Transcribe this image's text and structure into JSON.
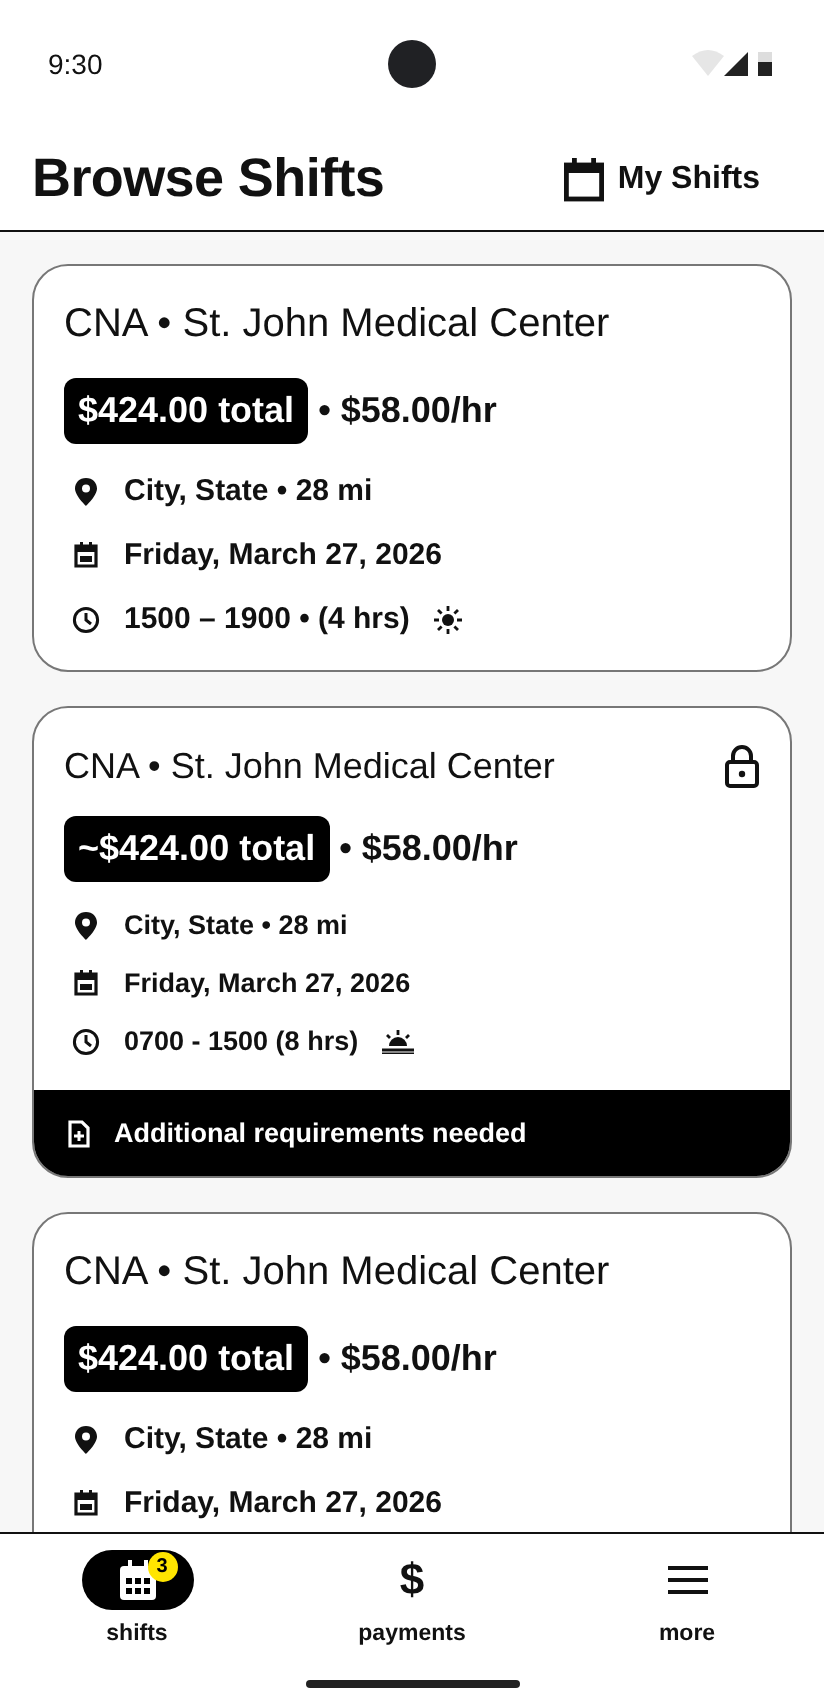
{
  "status_bar": {
    "time": "9:30"
  },
  "header": {
    "title": "Browse Shifts",
    "action": "My Shifts"
  },
  "shifts": [
    {
      "kind": "large",
      "title": "CNA • St. John Medical Center",
      "total": "$424.00 total",
      "rate": "• $58.00/hr",
      "locked": false,
      "location": "City, State • 28 mi",
      "date": "Friday, March 27, 2026",
      "time": {
        "text": "1500 – 1900 • (4 hrs)",
        "kind": "day"
      }
    },
    {
      "kind": "compact",
      "title": "CNA • St. John Medical Center",
      "total": "~$424.00 total",
      "rate": "• $58.00/hr",
      "locked": true,
      "location": "City, State • 28 mi",
      "date": "Friday, March 27, 2026",
      "time": {
        "text": "0700 - 1500 (8 hrs)",
        "kind": "sunrise"
      },
      "notice": "Additional requirements needed"
    },
    {
      "kind": "large",
      "title": "CNA • St. John Medical Center",
      "total": "$424.00 total",
      "rate": "• $58.00/hr",
      "locked": false,
      "location": "City, State • 28 mi",
      "date": "Friday, March 27, 2026"
    }
  ],
  "bottom_nav": [
    {
      "kind": "calendar",
      "label": "shifts",
      "selected": true,
      "badge": "3"
    },
    {
      "kind": "symbol",
      "symbol": "$",
      "label": "payments",
      "selected": false
    },
    {
      "kind": "menu",
      "label": "more",
      "selected": false
    }
  ]
}
